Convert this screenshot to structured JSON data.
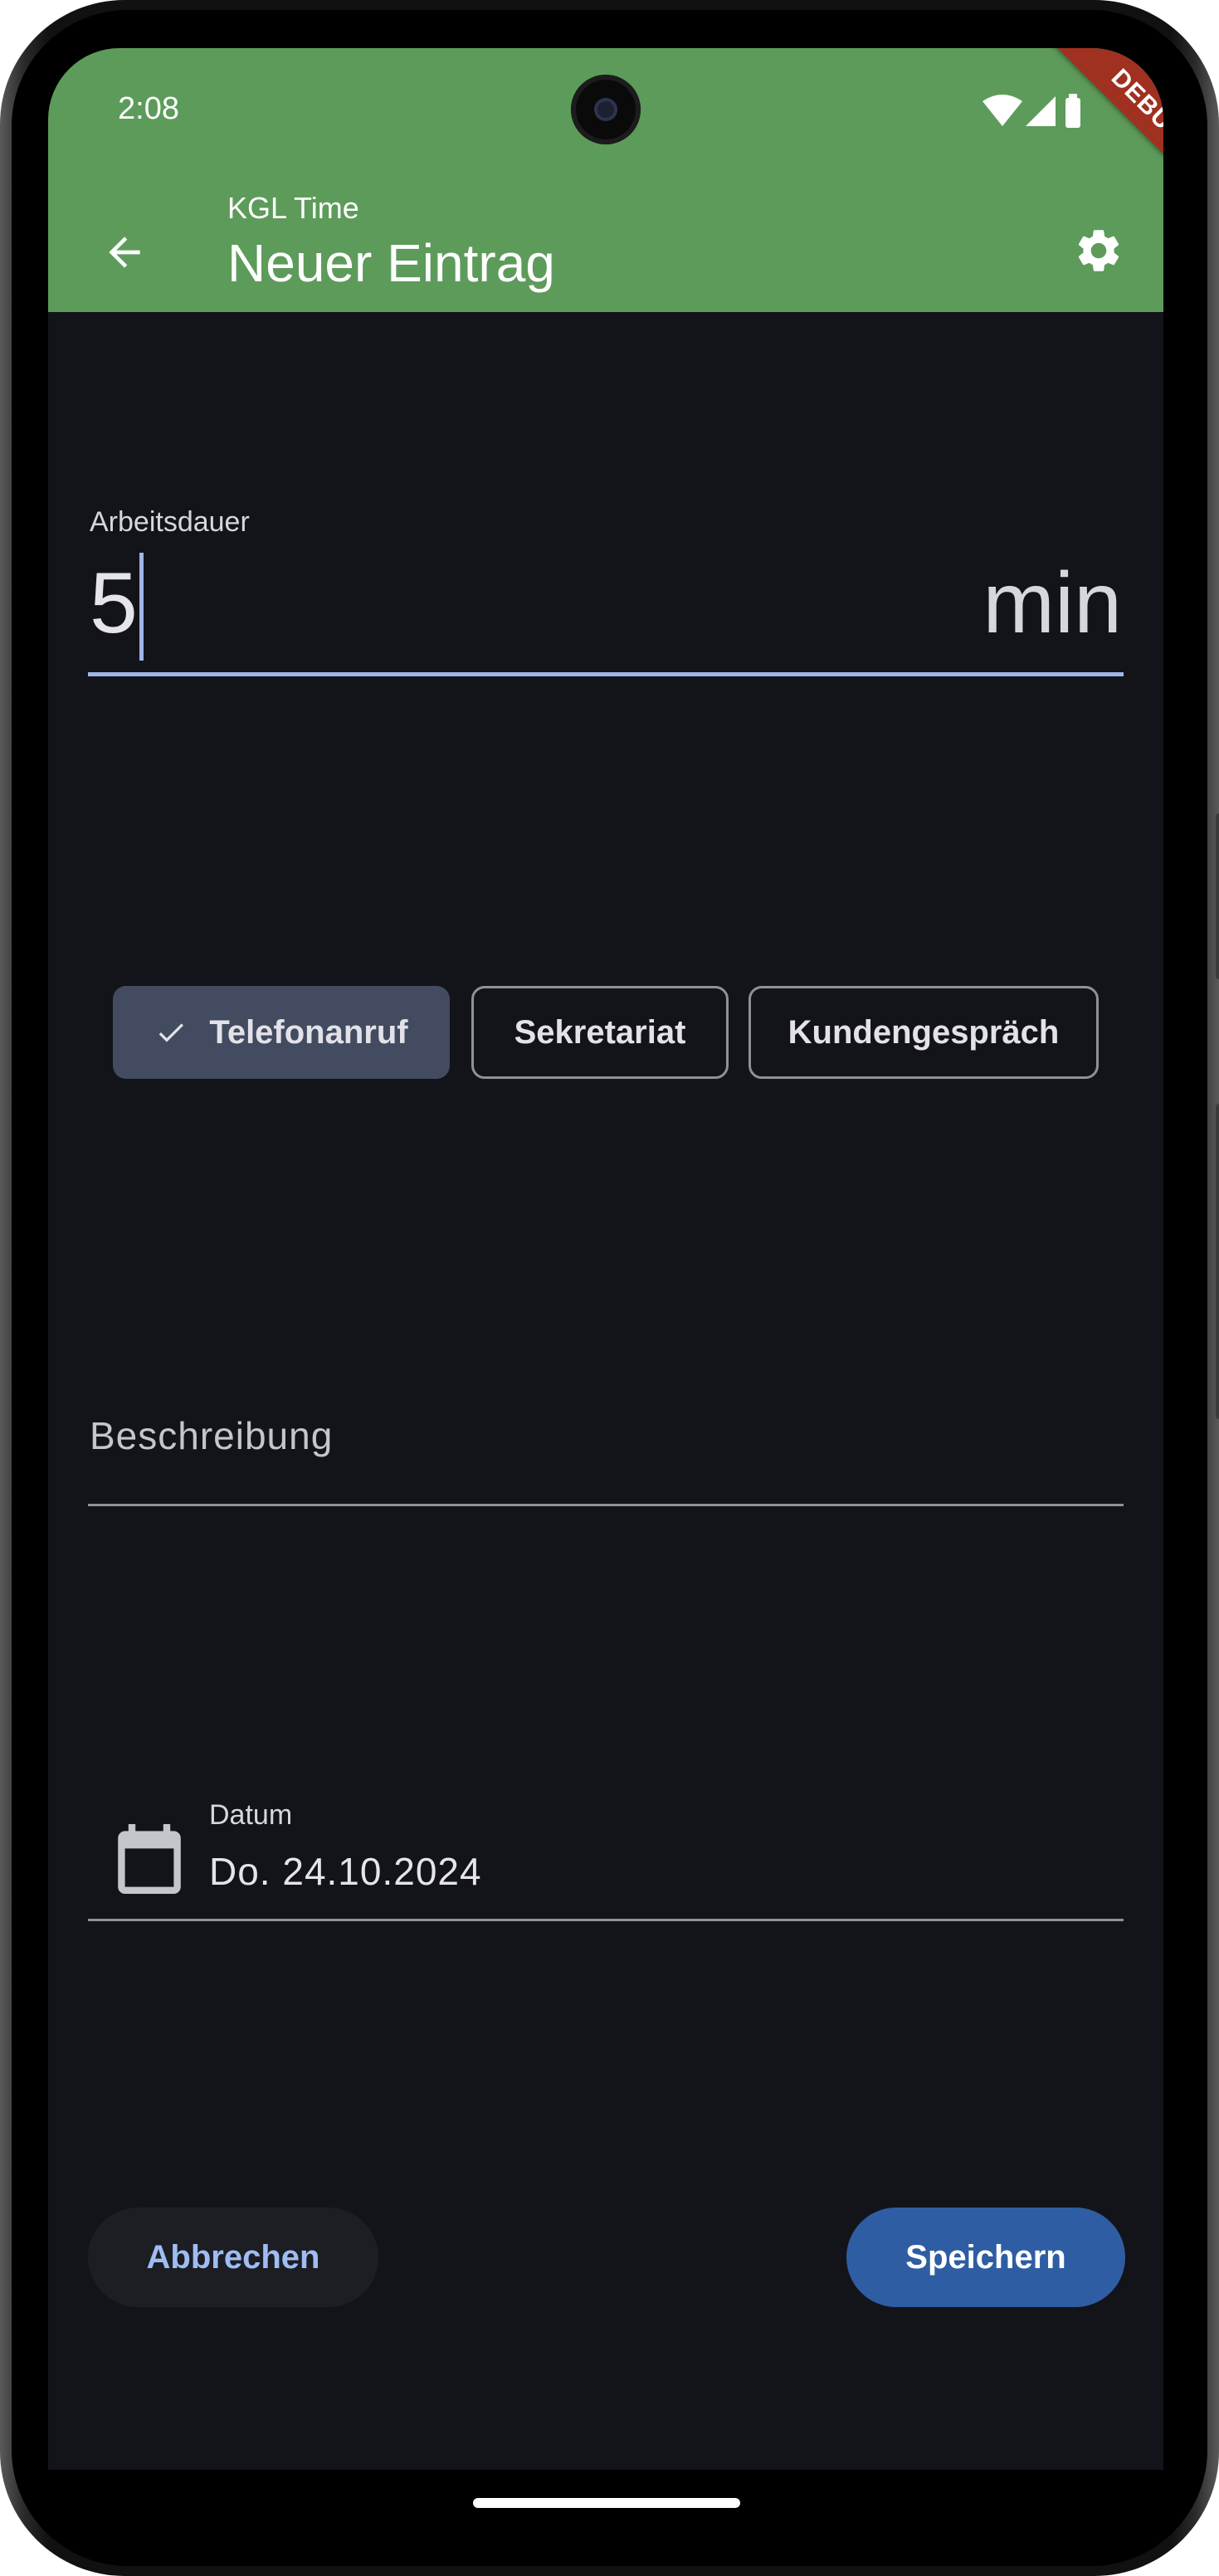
{
  "status_bar": {
    "time": "2:08"
  },
  "debug_banner": "DEBUG",
  "app_bar": {
    "subtitle": "KGL Time",
    "title": "Neuer Eintrag",
    "color": "#5d9b5a"
  },
  "form": {
    "duration": {
      "label": "Arbeitsdauer",
      "value": "5",
      "unit": "min"
    },
    "categories": [
      {
        "label": "Telefonanruf",
        "selected": true
      },
      {
        "label": "Sekretariat",
        "selected": false
      },
      {
        "label": "Kundengespräch",
        "selected": false
      }
    ],
    "description": {
      "placeholder": "Beschreibung"
    },
    "date": {
      "label": "Datum",
      "value": "Do. 24.10.2024"
    }
  },
  "actions": {
    "cancel": "Abbrechen",
    "save": "Speichern"
  },
  "icons": {
    "back": "arrow-left-icon",
    "settings": "gear-icon",
    "calendar": "calendar-icon",
    "check": "check-icon"
  },
  "colors": {
    "background": "#131419",
    "accent": "#9fb6ea",
    "save_button": "#2e5da3",
    "chip_selected": "#424b5f"
  }
}
